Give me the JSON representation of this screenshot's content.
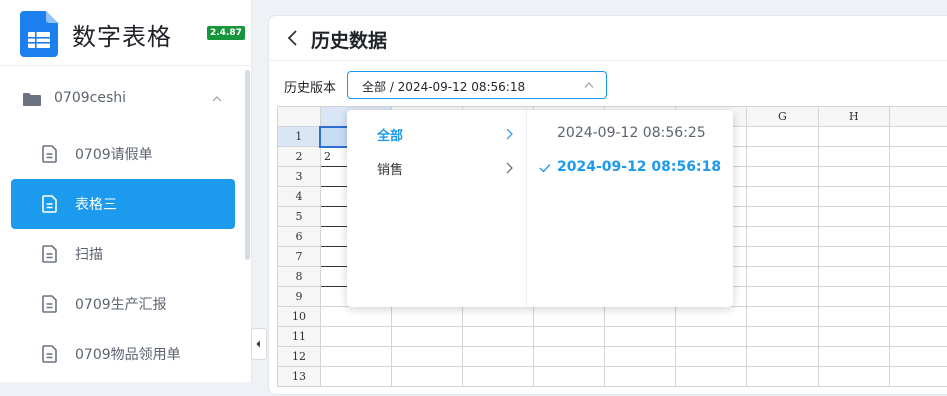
{
  "app": {
    "title": "数字表格",
    "version": "2.4.87"
  },
  "sidebar": {
    "folder": {
      "label": "0709ceshi",
      "icon": "folder-icon"
    },
    "items": [
      {
        "label": "0709请假单",
        "icon": "document-icon",
        "active": false
      },
      {
        "label": "表格三",
        "icon": "document-icon",
        "active": true
      },
      {
        "label": "扫描",
        "icon": "document-icon",
        "active": false
      },
      {
        "label": "0709生产汇报",
        "icon": "document-icon",
        "active": false
      },
      {
        "label": "0709物品领用单",
        "icon": "document-icon",
        "active": false
      }
    ]
  },
  "header": {
    "title": "历史数据"
  },
  "version_picker": {
    "label": "历史版本",
    "value": "全部 / 2024-09-12 08:56:18"
  },
  "cascader": {
    "categories": [
      {
        "label": "全部",
        "active": true
      },
      {
        "label": "销售",
        "active": false
      }
    ],
    "timestamps": [
      {
        "label": "2024-09-12 08:56:25",
        "selected": false
      },
      {
        "label": "2024-09-12 08:56:18",
        "selected": true
      }
    ]
  },
  "sheet": {
    "visible_columns": [
      "G",
      "H"
    ],
    "rows": [
      "1",
      "2",
      "3",
      "4",
      "5",
      "6",
      "7",
      "8",
      "9",
      "10",
      "11",
      "12",
      "13"
    ],
    "cell_A2": "2"
  },
  "colors": {
    "accent": "#1b9aee",
    "version_badge": "#17963c"
  }
}
